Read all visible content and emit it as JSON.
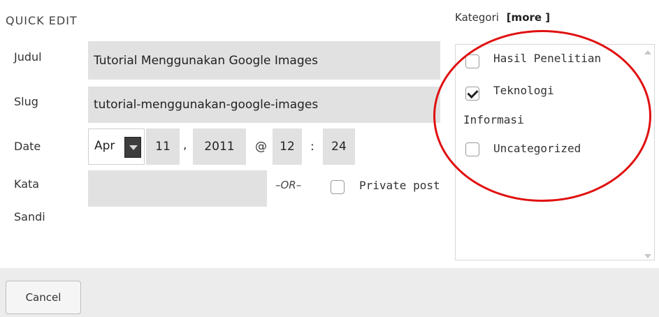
{
  "panel": {
    "heading": "QUICK EDIT"
  },
  "fields": {
    "title_label": "Judul",
    "title_value": "Tutorial Menggunakan Google Images",
    "slug_label": "Slug",
    "slug_value": "tutorial-menggunakan-google-images",
    "date_label": "Date",
    "month": "Apr",
    "day": "11",
    "comma": ",",
    "year": "2011",
    "at": "@",
    "hour": "12",
    "colon": ":",
    "minute": "24",
    "password_label_1": "Kata",
    "password_label_2": "Sandi",
    "password_value": "",
    "or_text": "–OR–",
    "private_label": "Private post",
    "private_checked": false
  },
  "categories": {
    "label": "Kategori",
    "more": "[more ]",
    "items": [
      {
        "label": "Hasil Penelitian",
        "checked": false
      },
      {
        "label": "Teknologi",
        "checked": true
      },
      {
        "label_cont": "Informasi"
      },
      {
        "label": "Uncategorized",
        "checked": false
      }
    ]
  },
  "actions": {
    "cancel_label": "Cancel"
  },
  "colors": {
    "field_bg": "#e1e1e1",
    "highlight_circle": "#e01010",
    "footer_bg": "#ececec"
  },
  "icons": {
    "month_dropdown": "chevron-down-icon",
    "scroll_up": "scroll-up-icon",
    "scroll_down": "scroll-down-icon"
  }
}
